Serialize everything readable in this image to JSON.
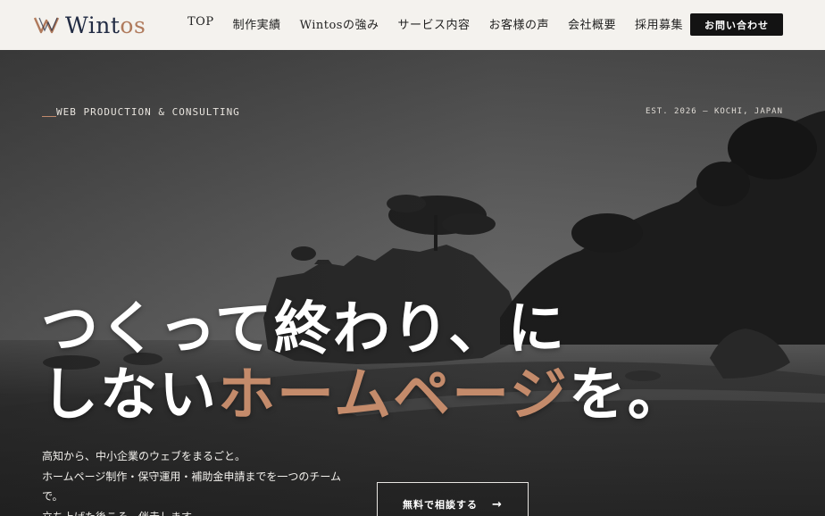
{
  "header": {
    "logo_mark": "W",
    "logo_text_main": "Wint",
    "logo_text_tail": "os",
    "nav": [
      "TOP",
      "制作実績",
      "Wintosの強み",
      "サービス内容",
      "お客様の声",
      "会社概要",
      "採用募集"
    ],
    "contact_label": "お問い合わせ"
  },
  "hero": {
    "tagline": "WEB PRODUCTION & CONSULTING",
    "est": "EST. 2026 — KOCHI, JAPAN",
    "headline_line1": "つくって終わり、に",
    "headline_line2_plain": "しない",
    "headline_line2_accent": "ホームページ",
    "headline_line2_end": "を。",
    "lead_lines": [
      "高知から、中小企業のウェブをまるごと。",
      "ホームページ制作・保守運用・補助金申請までを一つのチーム",
      "で。",
      "立ち上げた後こそ、伴走します。"
    ],
    "cta_label": "無料で相談する",
    "cta_arrow": "→"
  },
  "colors": {
    "accent": "#c48b6b",
    "navy": "#222c44",
    "header_bg": "#f4f2ee",
    "button_dark": "#131313"
  },
  "icons": [
    "w-monogram-logo",
    "arrow-right-icon"
  ]
}
